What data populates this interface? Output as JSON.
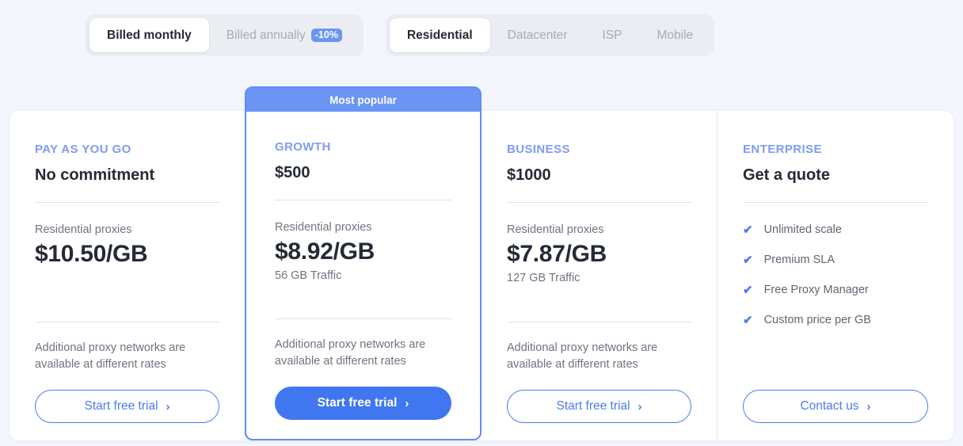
{
  "billing_toggle": {
    "options": [
      {
        "label": "Billed monthly",
        "active": true,
        "badge": ""
      },
      {
        "label": "Billed annually",
        "active": false,
        "badge": "-10%"
      }
    ]
  },
  "product_tabs": {
    "options": [
      {
        "label": "Residential",
        "active": true
      },
      {
        "label": "Datacenter",
        "active": false
      },
      {
        "label": "ISP",
        "active": false
      },
      {
        "label": "Mobile",
        "active": false
      }
    ]
  },
  "popular_banner_label": "Most popular",
  "shared": {
    "note": "Additional proxy networks are available at different rates",
    "unit_label": "Residential proxies",
    "cta_trial": "Start free trial",
    "cta_contact": "Contact us",
    "chevron": "›",
    "check": "✔"
  },
  "plans": [
    {
      "label": "PAY AS YOU GO",
      "price": "No commitment",
      "unit_label": "Residential proxies",
      "unit_price": "$10.50/GB",
      "traffic": "",
      "note": "Additional proxy networks are available at different rates",
      "cta": "Start free trial"
    },
    {
      "label": "GROWTH",
      "price": "$500",
      "unit_label": "Residential proxies",
      "unit_price": "$8.92/GB",
      "traffic": "56 GB Traffic",
      "note": "Additional proxy networks are available at different rates",
      "cta": "Start free trial"
    },
    {
      "label": "BUSINESS",
      "price": "$1000",
      "unit_label": "Residential proxies",
      "unit_price": "$7.87/GB",
      "traffic": "127 GB Traffic",
      "note": "Additional proxy networks are available at different rates",
      "cta": "Start free trial"
    },
    {
      "label": "ENTERPRISE",
      "price": "Get a quote",
      "features": [
        "Unlimited scale",
        "Premium SLA",
        "Free Proxy Manager",
        "Custom price per GB"
      ],
      "cta": "Contact us"
    }
  ],
  "colors": {
    "page_bg": "#f4f6fd",
    "accent_blue": "#4077f0",
    "plan_label_blue": "#7f9cf0",
    "banner_blue": "#6b95f5",
    "text_dark": "#252a36",
    "text_muted": "#6e7480"
  }
}
